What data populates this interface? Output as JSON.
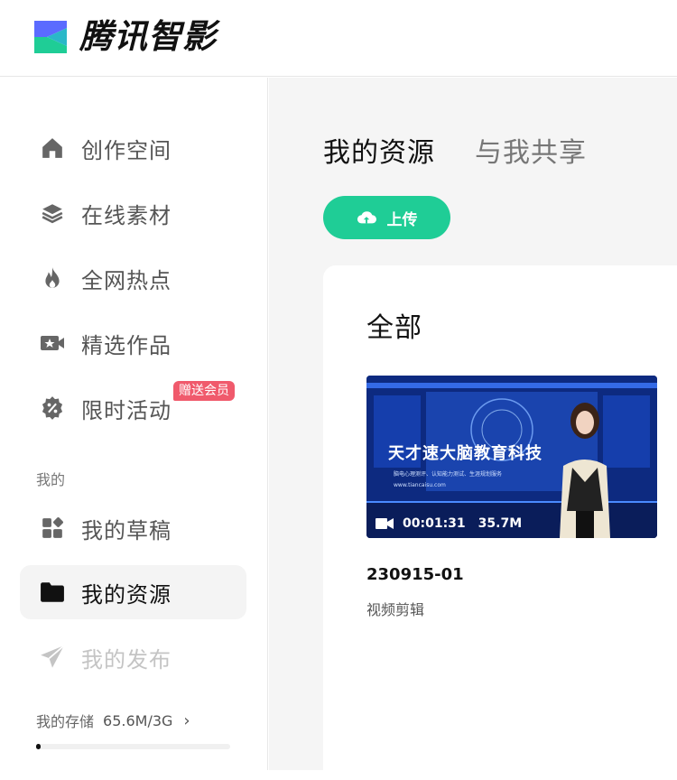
{
  "brand": {
    "name": "腾讯智影",
    "colors": {
      "accent": "#1fcd96",
      "badge": "#f05a6c",
      "logo_top": "#5b6bff",
      "logo_bottom": "#1fcd96"
    }
  },
  "sidebar": {
    "items": [
      {
        "label": "创作空间",
        "icon": "home-icon"
      },
      {
        "label": "在线素材",
        "icon": "layers-icon"
      },
      {
        "label": "全网热点",
        "icon": "flame-icon"
      },
      {
        "label": "精选作品",
        "icon": "star-video-icon"
      },
      {
        "label": "限时活动",
        "icon": "discount-icon",
        "badge": "赠送会员"
      }
    ],
    "section_label": "我的",
    "my_items": [
      {
        "label": "我的草稿",
        "icon": "apps-icon"
      },
      {
        "label": "我的资源",
        "icon": "folder-icon",
        "active": true
      },
      {
        "label": "我的发布",
        "icon": "send-icon",
        "disabled": true
      }
    ],
    "storage": {
      "label": "我的存储",
      "value": "65.6M/3G",
      "used_fraction": 0.021
    }
  },
  "main": {
    "tabs": [
      {
        "label": "我的资源",
        "active": true
      },
      {
        "label": "与我共享"
      }
    ],
    "upload_label": "上传",
    "panel_title": "全部",
    "files": [
      {
        "name": "230915-01",
        "type": "视频剪辑",
        "duration": "00:01:31",
        "size": "35.7M",
        "thumbnail_title": "天才速大脑教育科技",
        "thumbnail_subtitle": "脑电心理测评、认知能力测试、生涯规划服务",
        "thumbnail_url": "www.tiancaisu.com"
      }
    ]
  }
}
